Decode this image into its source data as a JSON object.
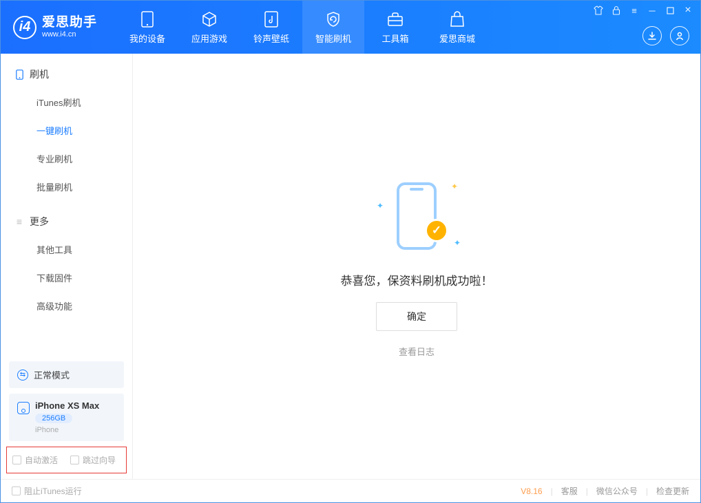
{
  "colors": {
    "primary": "#1b7dff",
    "accent_orange": "#ffb300",
    "red_highlight": "#e53935"
  },
  "header": {
    "app_name": "爱思助手",
    "app_url": "www.i4.cn",
    "nav": {
      "my_device": "我的设备",
      "apps_games": "应用游戏",
      "ring_wall": "铃声壁纸",
      "smart_flash": "智能刷机",
      "toolbox": "工具箱",
      "store": "爱思商城"
    }
  },
  "sidebar": {
    "flash": {
      "title": "刷机",
      "items": {
        "itunes": "iTunes刷机",
        "onekey": "一键刷机",
        "pro": "专业刷机",
        "batch": "批量刷机"
      }
    },
    "more": {
      "title": "更多",
      "items": {
        "other_tools": "其他工具",
        "download_fw": "下载固件",
        "advanced": "高级功能"
      }
    },
    "mode_row": "正常模式",
    "device": {
      "name": "iPhone XS Max",
      "storage": "256GB",
      "type": "iPhone"
    },
    "checkboxes": {
      "auto_activate": "自动激活",
      "skip_guide": "跳过向导"
    }
  },
  "main": {
    "success_text": "恭喜您，保资料刷机成功啦！",
    "ok_button": "确定",
    "view_log": "查看日志"
  },
  "footer": {
    "block_itunes": "阻止iTunes运行",
    "version": "V8.16",
    "support": "客服",
    "wechat": "微信公众号",
    "check_update": "检查更新"
  }
}
